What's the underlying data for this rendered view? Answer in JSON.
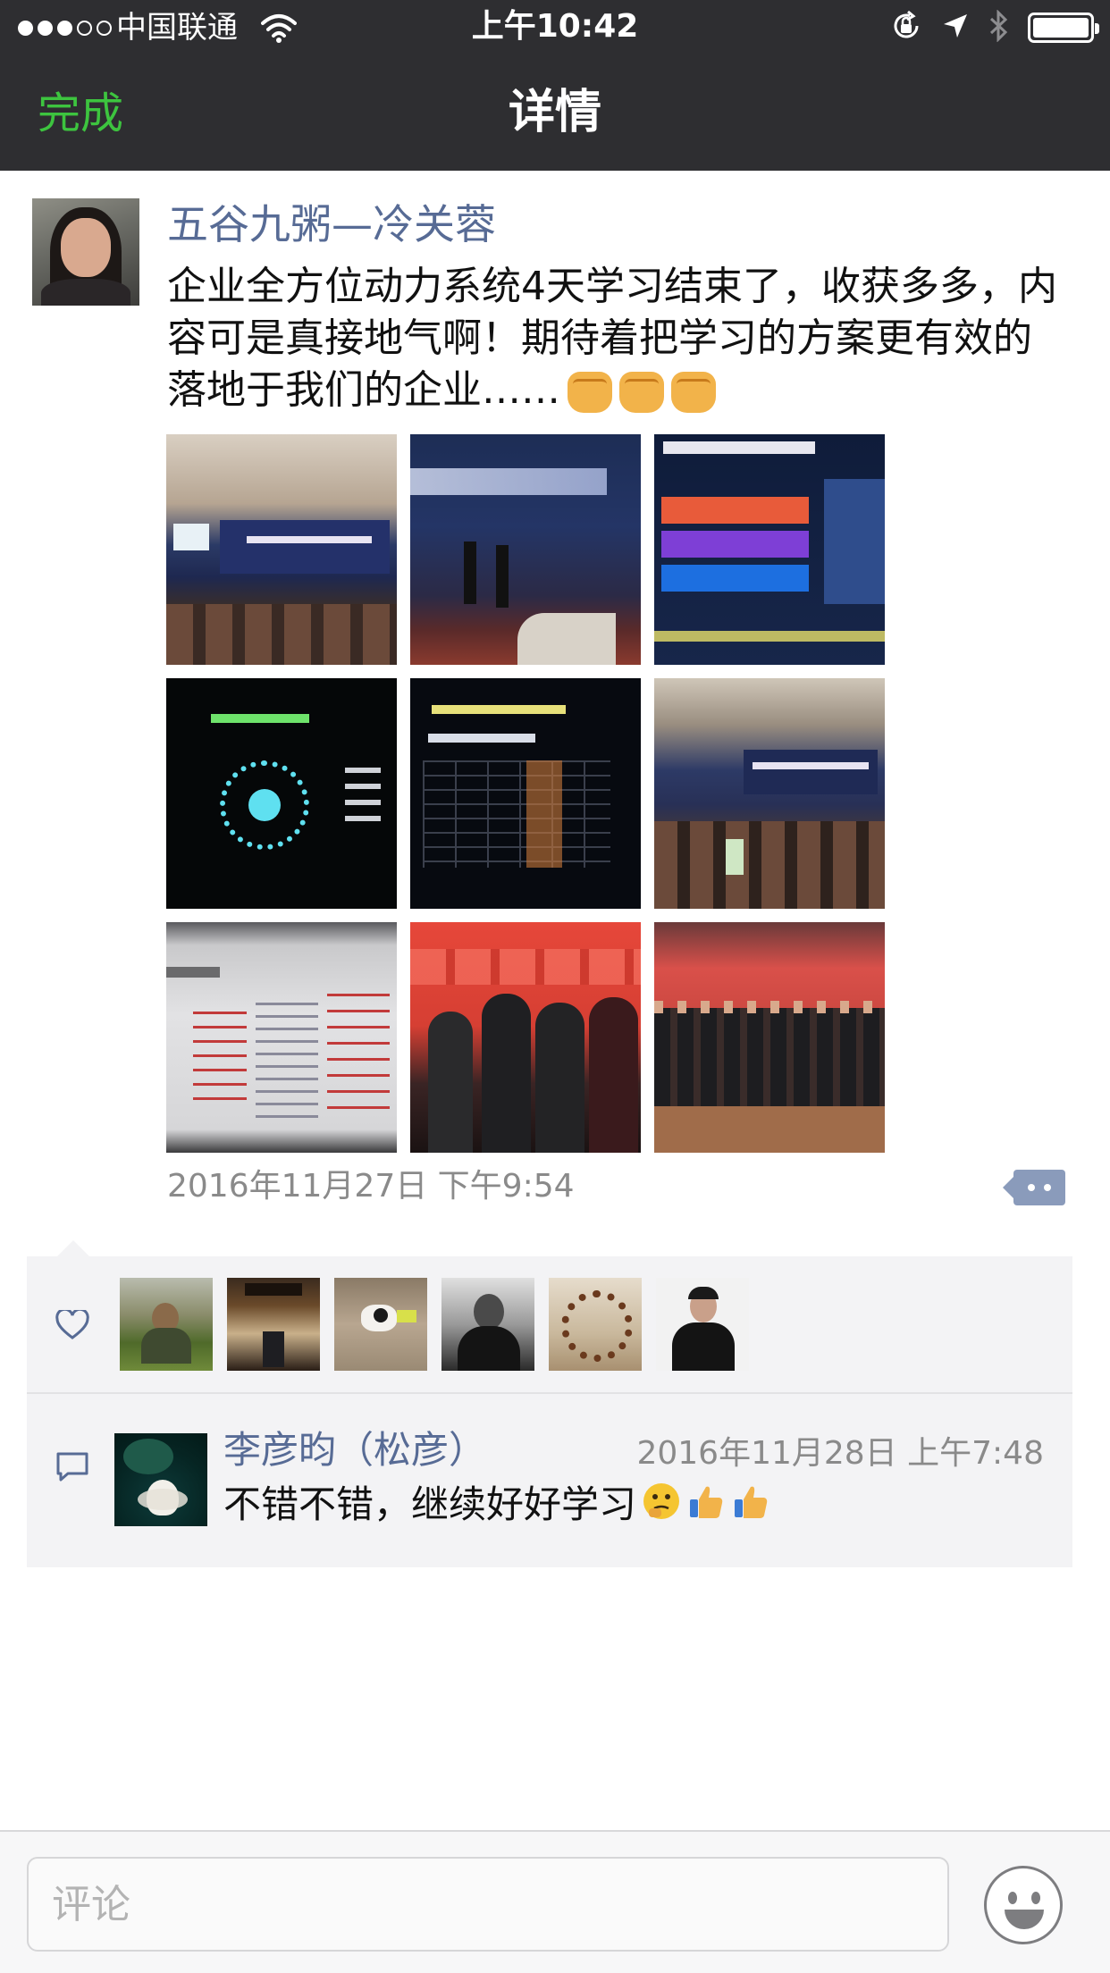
{
  "status_bar": {
    "carrier": "中国联通",
    "time": "上午10:42"
  },
  "nav": {
    "done_label": "完成",
    "title": "详情"
  },
  "post": {
    "author": "五谷九粥—冷关蓉",
    "text": "企业全方位动力系统4天学习结束了，收获多多，内容可是真接地气啊！期待着把学习的方案更有效的落地于我们的企业……",
    "emoji": [
      "fist-emoji",
      "fist-emoji",
      "fist-emoji"
    ],
    "timestamp": "2016年11月27日 下午9:54",
    "photos": [
      {
        "name": "photo-conference-hall"
      },
      {
        "name": "photo-stage-banner"
      },
      {
        "name": "photo-slide-principle"
      },
      {
        "name": "photo-slide-partner"
      },
      {
        "name": "photo-slide-table"
      },
      {
        "name": "photo-audience"
      },
      {
        "name": "photo-screen-framework"
      },
      {
        "name": "photo-group-four"
      },
      {
        "name": "photo-group-large"
      }
    ]
  },
  "likes": {
    "icon": "heart-icon",
    "count": 6
  },
  "comment": {
    "icon": "comment-icon",
    "author": "李彦昀（松彦）",
    "time": "2016年11月28日 上午7:48",
    "text": "不错不错，继续好好学习",
    "emoji": [
      "thinking-emoji",
      "thumbs-up-emoji",
      "thumbs-up-emoji"
    ]
  },
  "input": {
    "placeholder": "评论"
  },
  "colors": {
    "nav_bg": "#2e2e31",
    "done_green": "#3dc43f",
    "author_blue": "#576b95",
    "meta_gray": "#8a8a8a",
    "panel_bg": "#f3f3f5"
  }
}
